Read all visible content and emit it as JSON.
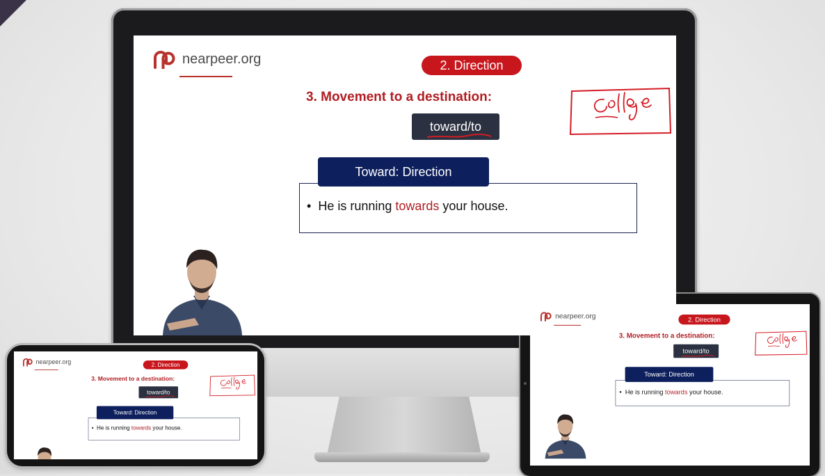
{
  "brand": {
    "logo_text": "nearpeer.org"
  },
  "slide": {
    "section_pill": "2. Direction",
    "heading": "3.  Movement to a destination:",
    "chip_label": "toward/to",
    "tab_title": "Toward: Direction",
    "bullet": {
      "marker": "•",
      "before": "He is running ",
      "highlight": "towards",
      "after": " your house."
    }
  },
  "colors": {
    "accent_red": "#c8161d",
    "navy": "#0d1f5c",
    "chip_dark": "#2b3140"
  }
}
